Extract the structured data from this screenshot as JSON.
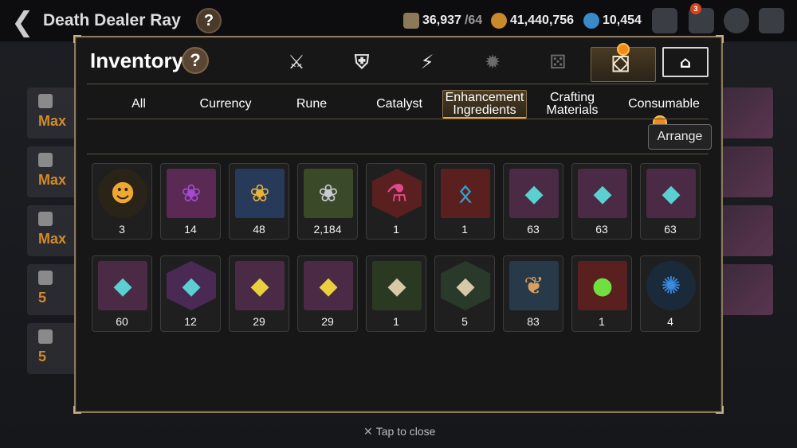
{
  "topbar": {
    "hero_name": "Death Dealer Ray",
    "help": "?",
    "stamina": "36,937",
    "stamina_max": "/64",
    "gold": "41,440,756",
    "skystone": "10,454",
    "mail_badge": "3"
  },
  "inventory": {
    "title": "Inventory",
    "help": "?",
    "arrange_label": "Arrange",
    "subtabs": [
      "All",
      "Currency",
      "Rune",
      "Catalyst",
      "Enhancement\nIngredients",
      "Crafting\nMaterials",
      "Consumable"
    ],
    "active_subtab": "Enhancement Ingredients",
    "items": [
      {
        "count": "3",
        "icon": "penguin-icon",
        "color": "#f0a830"
      },
      {
        "count": "14",
        "icon": "purple-flower-icon",
        "color": "#a24ad0"
      },
      {
        "count": "48",
        "icon": "gold-flower-icon",
        "color": "#e8b23a"
      },
      {
        "count": "2,184",
        "icon": "silver-flower-icon",
        "color": "#c8ccd2"
      },
      {
        "count": "1",
        "icon": "potion-icon",
        "color": "#e04a8a"
      },
      {
        "count": "1",
        "icon": "rune-stone-icon",
        "color": "#3aa0c8"
      },
      {
        "count": "63",
        "icon": "stone-icon",
        "color": "#5ad0d0"
      },
      {
        "count": "63",
        "icon": "stone-icon",
        "color": "#5ad0d0"
      },
      {
        "count": "63",
        "icon": "stone-icon",
        "color": "#5ad0d0"
      },
      {
        "count": "60",
        "icon": "stone-icon",
        "color": "#5ad0d0"
      },
      {
        "count": "12",
        "icon": "stone-icon",
        "color": "#5ad0d0"
      },
      {
        "count": "29",
        "icon": "stone-icon",
        "color": "#e8d040"
      },
      {
        "count": "29",
        "icon": "stone-icon",
        "color": "#e8d040"
      },
      {
        "count": "1",
        "icon": "stone-icon",
        "color": "#d8c8a8"
      },
      {
        "count": "5",
        "icon": "stone-icon",
        "color": "#d8c8a8"
      },
      {
        "count": "83",
        "icon": "root-icon",
        "color": "#d8a060"
      },
      {
        "count": "1",
        "icon": "green-gem-icon",
        "color": "#70e040"
      },
      {
        "count": "4",
        "icon": "blue-orb-icon",
        "color": "#3a8ae0"
      }
    ]
  },
  "close_hint": "Tap to close",
  "side_labels": [
    "Max",
    "Max",
    "Max",
    "5",
    "5"
  ],
  "colors": {
    "accent": "#f0a83a",
    "panel_border": "#8a7a60"
  }
}
